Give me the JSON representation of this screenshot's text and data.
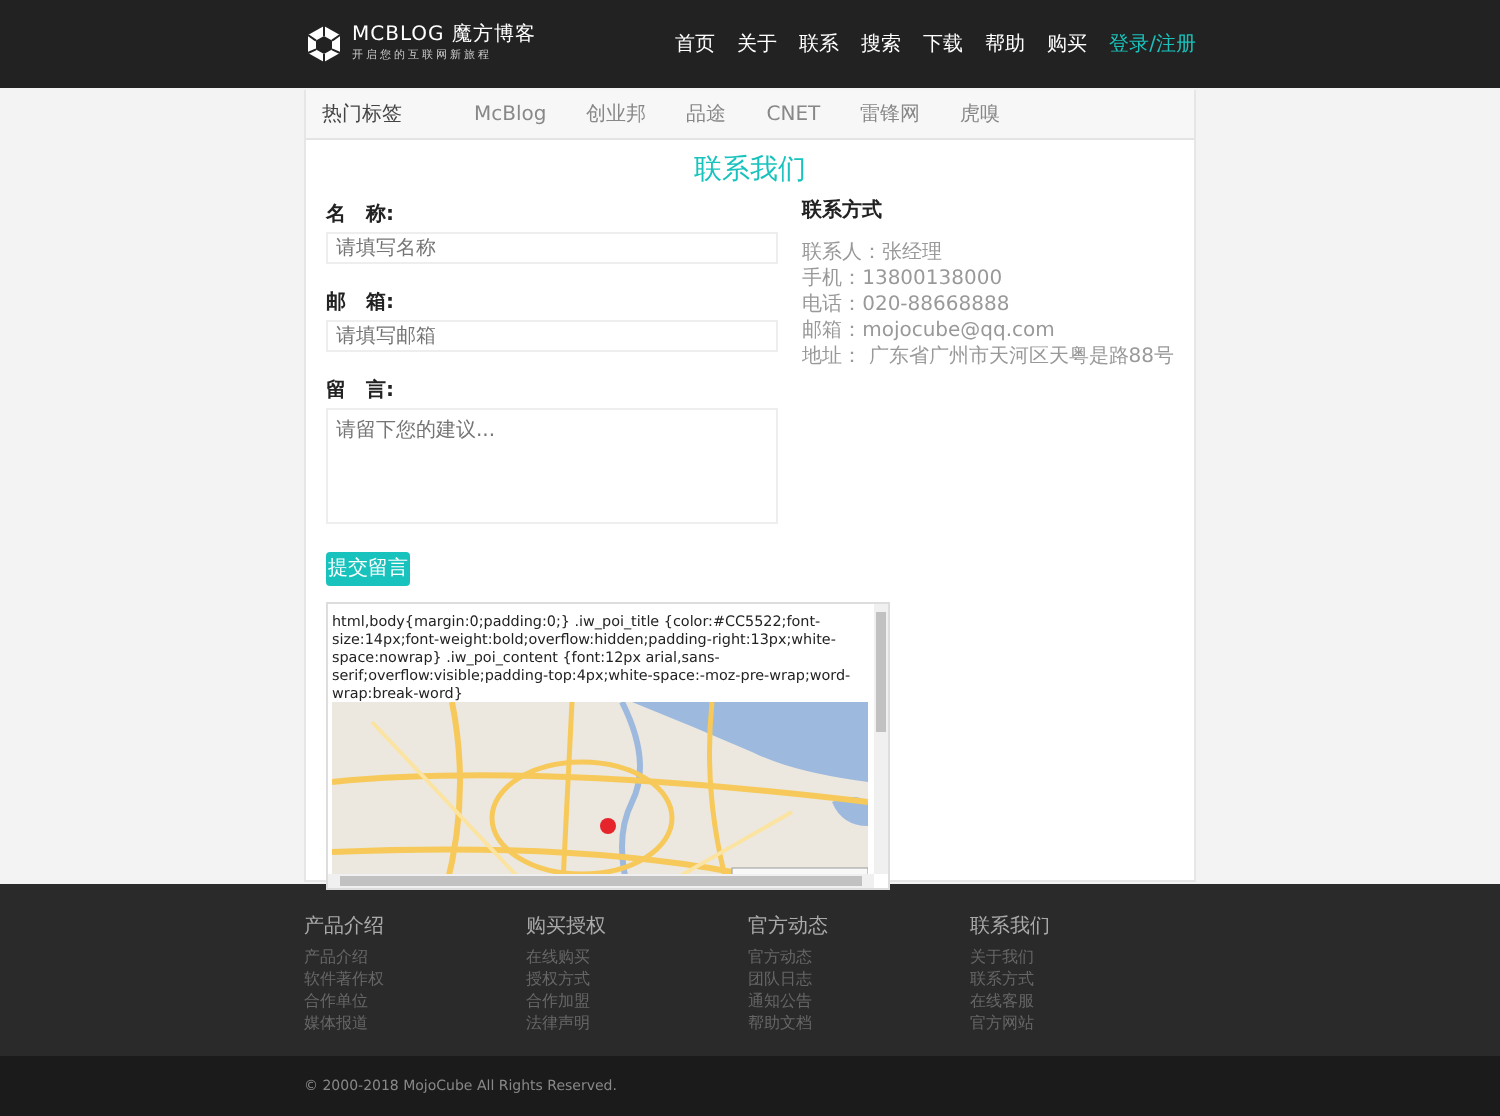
{
  "header": {
    "logo_title": "MCBLOG 魔方博客",
    "logo_subtitle": "开启您的互联网新旅程",
    "nav": [
      {
        "label": "首页",
        "kind": "link"
      },
      {
        "label": "关于",
        "kind": "link"
      },
      {
        "label": "联系",
        "kind": "link"
      },
      {
        "label": "搜索",
        "kind": "link"
      },
      {
        "label": "下载",
        "kind": "link"
      },
      {
        "label": "帮助",
        "kind": "link"
      },
      {
        "label": "购买",
        "kind": "link"
      },
      {
        "label": "登录/注册",
        "kind": "accent"
      }
    ]
  },
  "tag_bar": {
    "title": "热门标签",
    "tags": [
      "McBlog",
      "创业邦",
      "品途",
      "CNET",
      "雷锋网",
      "虎嗅"
    ]
  },
  "contact": {
    "title": "联系我们",
    "form": {
      "fields": [
        {
          "label": "名　称:",
          "placeholder": "请填写名称",
          "kind": "input"
        },
        {
          "label": "邮　箱:",
          "placeholder": "请填写邮箱",
          "kind": "input"
        },
        {
          "label": "留　言:",
          "placeholder": "请留下您的建议...",
          "kind": "textarea"
        }
      ],
      "submit": "提交留言"
    },
    "info": {
      "title": "联系方式",
      "lines": [
        "联系人：张经理",
        "手机：13800138000",
        "电话：020-88668888",
        "邮箱：mojocube@qq.com",
        "地址： 广东省广州市天河区天粤是路88号"
      ]
    },
    "map_frame": {
      "code_text": "html,body{margin:0;padding:0;} .iw_poi_title {color:#CC5522;font-size:14px;font-weight:bold;overflow:hidden;padding-right:13px;white-space:nowrap} .iw_poi_content {font:12px arial,sans-serif;overflow:visible;padding-top:4px;white-space:-moz-pre-wrap;word-wrap:break-word}"
    }
  },
  "footer": {
    "columns": [
      {
        "title": "产品介绍",
        "links": [
          "产品介绍",
          "软件著作权",
          "合作单位",
          "媒体报道"
        ]
      },
      {
        "title": "购买授权",
        "links": [
          "在线购买",
          "授权方式",
          "合作加盟",
          "法律声明"
        ]
      },
      {
        "title": "官方动态",
        "links": [
          "官方动态",
          "团队日志",
          "通知公告",
          "帮助文档"
        ]
      },
      {
        "title": "联系我们",
        "links": [
          "关于我们",
          "联系方式",
          "在线客服",
          "官方网站"
        ]
      }
    ],
    "copyright": "© 2000-2018 MojoCube All Rights Reserved."
  }
}
